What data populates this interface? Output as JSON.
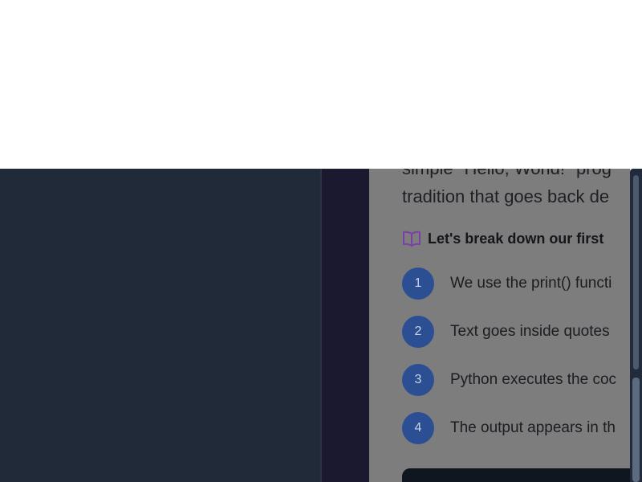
{
  "lesson": {
    "intro_line1": "simple \"Hello, World!\" prog",
    "intro_line2": "tradition that goes back de",
    "breakdown_heading": "Let's break down our first",
    "steps": [
      {
        "number": "1",
        "text": "We use the print() functi"
      },
      {
        "number": "2",
        "text": "Text goes inside quotes"
      },
      {
        "number": "3",
        "text": "Python executes the coc"
      },
      {
        "number": "4",
        "text": "The output appears in th"
      }
    ]
  },
  "icons": {
    "heading_icon": "book-open-icon"
  },
  "colors": {
    "sidebar_bg": "#202a38",
    "gutter_bg": "#1a192f",
    "content_bg": "#7d7d7d",
    "step_badge": "#2c4f93",
    "book_icon": "#7b3fa8",
    "code_bg": "#0f1620"
  }
}
